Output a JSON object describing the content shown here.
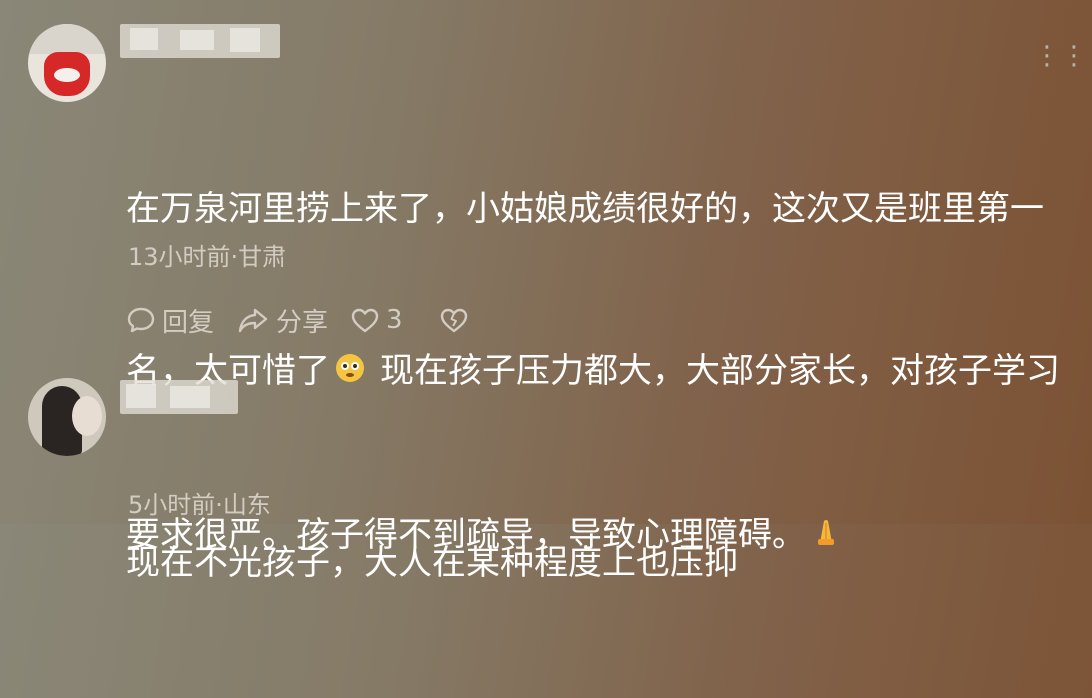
{
  "comments": [
    {
      "text_lines": [
        "在万泉河里捞上来了，小姑娘成绩很好的，这次又是班里第一",
        "名，太可惜了",
        "现在孩子压力都大，大部分家长，对孩子学习",
        "要求很严。孩子得不到疏导，导致心理障碍。"
      ],
      "emoji_1": "flushed-face-emoji",
      "emoji_2": "folded-hands-emoji",
      "meta": "13小时前·甘肃",
      "actions": {
        "reply_label": "回复",
        "share_label": "分享",
        "like_count": "3",
        "icons": [
          "comment-icon",
          "share-icon",
          "heart-icon",
          "broken-heart-icon"
        ]
      }
    },
    {
      "text_lines": [
        "现在不光孩子，大人在某种程度上也压抑"
      ],
      "meta": "5小时前·山东"
    }
  ],
  "colors": {
    "background_start": "#8a8778",
    "background_end": "#7c5234",
    "text": "#ffffff",
    "meta_text": "#d2ccc2"
  }
}
